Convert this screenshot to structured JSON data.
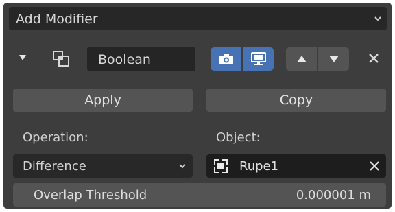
{
  "header": {
    "title": "Add Modifier",
    "dropdown_icon": "chevron-down-icon"
  },
  "modifier": {
    "collapse_icon": "triangle-down-icon",
    "type_icon": "boolean-modifier-icon",
    "name": "Boolean",
    "toggles": [
      {
        "name": "render-toggle",
        "icon": "camera-icon",
        "active": true
      },
      {
        "name": "viewport-toggle",
        "icon": "monitor-icon",
        "active": true
      }
    ],
    "move_up_icon": "arrow-up-icon",
    "move_down_icon": "arrow-down-icon",
    "remove_icon": "close-icon"
  },
  "actions": {
    "apply_label": "Apply",
    "copy_label": "Copy"
  },
  "operation": {
    "label": "Operation:",
    "value": "Difference"
  },
  "object": {
    "label": "Object:",
    "value": "Rupe1",
    "icon": "cube-icon",
    "clear_icon": "close-icon"
  },
  "overlap": {
    "label": "Overlap Threshold",
    "value": "0.000001 m"
  },
  "colors": {
    "panel_bg": "#3d3d3d",
    "accent": "#4772b3",
    "button": "#545454",
    "field_dark": "#252525"
  }
}
